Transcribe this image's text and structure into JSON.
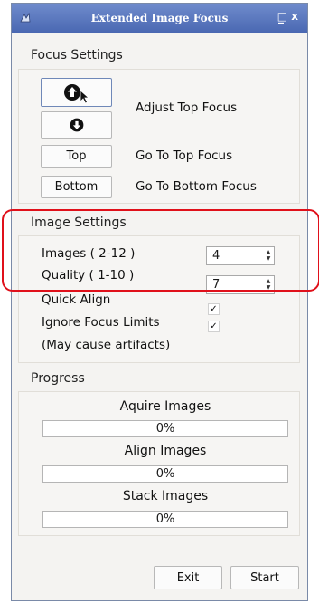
{
  "window": {
    "title": "Extended Image Focus",
    "app_icon": "app-logo-icon",
    "min_glyph": "_",
    "close_glyph": "□ x"
  },
  "focus_settings": {
    "heading": "Focus Settings",
    "up_icon": "arrow-up-circle-icon",
    "down_icon": "arrow-down-circle-icon",
    "adjust_label": "Adjust Top Focus",
    "top_button": "Top",
    "top_label": "Go To Top Focus",
    "bottom_button": "Bottom",
    "bottom_label": "Go To Bottom Focus"
  },
  "image_settings": {
    "heading": "Image Settings",
    "images_label": "Images ( 2-12 )",
    "images_value": "4",
    "quality_label": "Quality ( 1-10 )",
    "quality_value": "7",
    "quick_align_label": "Quick Align",
    "quick_align_checked": true,
    "ignore_limits_label": "Ignore Focus Limits",
    "ignore_limits_checked": true,
    "note": "(May cause artifacts)"
  },
  "progress": {
    "heading": "Progress",
    "items": [
      {
        "label": "Aquire Images",
        "text": "0%",
        "value": 0
      },
      {
        "label": "Align Images",
        "text": "0%",
        "value": 0
      },
      {
        "label": "Stack Images",
        "text": "0%",
        "value": 0
      }
    ]
  },
  "footer": {
    "exit_label": "Exit",
    "start_label": "Start"
  },
  "annotation": {
    "color": "#e0101a"
  },
  "colors": {
    "titlebar": "#5a78c0",
    "progress_fill": "#5b8ad6"
  }
}
